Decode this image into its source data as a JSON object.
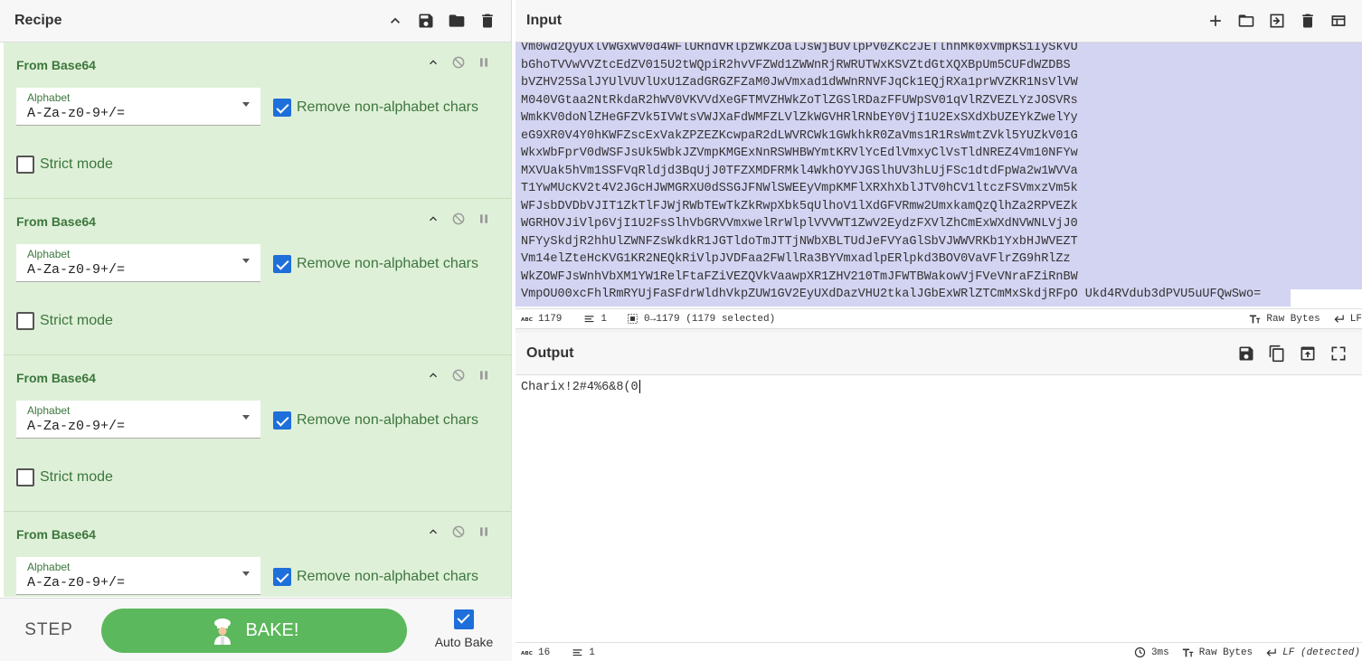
{
  "recipe": {
    "title": "Recipe",
    "header_icons": [
      "chevron-up-icon",
      "save-icon",
      "folder-icon",
      "trash-icon"
    ],
    "operations": [
      {
        "name": "From Base64",
        "alphabet_label": "Alphabet",
        "alphabet_value": "A-Za-z0-9+/=",
        "remove_label": "Remove non-alphabet chars",
        "remove_checked": true,
        "strict_label": "Strict mode",
        "strict_checked": false
      },
      {
        "name": "From Base64",
        "alphabet_label": "Alphabet",
        "alphabet_value": "A-Za-z0-9+/=",
        "remove_label": "Remove non-alphabet chars",
        "remove_checked": true,
        "strict_label": "Strict mode",
        "strict_checked": false
      },
      {
        "name": "From Base64",
        "alphabet_label": "Alphabet",
        "alphabet_value": "A-Za-z0-9+/=",
        "remove_label": "Remove non-alphabet chars",
        "remove_checked": true,
        "strict_label": "Strict mode",
        "strict_checked": false
      },
      {
        "name": "From Base64",
        "alphabet_label": "Alphabet",
        "alphabet_value": "A-Za-z0-9+/=",
        "remove_label": "Remove non-alphabet chars",
        "remove_checked": true,
        "strict_label": "Strict mode",
        "strict_checked": false
      }
    ],
    "step_label": "STEP",
    "bake_label": "BAKE!",
    "auto_bake_label": "Auto Bake",
    "auto_bake_checked": true
  },
  "input": {
    "title": "Input",
    "header_icons": [
      "plus-icon",
      "folder-icon",
      "import-icon",
      "trash-icon",
      "layout-icon"
    ],
    "lines": [
      "Vm0wd2QyUXlVWGxWV0d4WFlURndVRlpzWkZOalJsWjBUVlpPV0ZKc2JETlhhMk0xVmpKS1IySkVU",
      "bGhoTVVwVVZtcEdZV015U2tWQpiR2hvVFZWd1ZWWnRjRWRUTWxKSVZtdGtXQXBpUm5CUFdWZDBS",
      "bVZHV25SalJYUlVUVlUxU1ZadGRGZFZaM0JwVmxad1dWWnRNVFJqCk1EQjRXa1prWVZKR1NsVlVW",
      "M040VGtaa2NtRkdaR2hWV0VKVVdXeGFTMVZHWkZoTlZGSlRDazFFUWpSV01qVlRZVEZLYzJOSVRs",
      "WmkKV0doNlZHeGFZVk5IVWtsVWJXaFdWMFZLVlZkWGVHRlRNbEY0VjI1U2ExSXdXbUZEYkZwelYy",
      "eG9XR0V4Y0hKWFZscExVakZPZEZKcwpaR2dLWVRCWk1GWkhkR0ZaVms1R1RsWmtZVkl5YUZkV01G",
      "WkxWbFprV0dWSFJsUk5WbkJZVmpKMGExNnRSWHBWYmtKRVlYcEdlVmxyClVsTldNREZ4Vm10NFYw",
      "MXVUak5hVm1SSFVqRldjd3BqUjJ0TFZXMDFRMkl4WkhOYVJGSlhUV3hLUjFSc1dtdFpWa2w1WVVa",
      "T1YwMUcKV2t4V2JGcHJWMGRXU0dSSGJFNWlSWEEyVmpKMFlXRXhXblJTV0hCV1ltczFSVmxzVm5k",
      "WFJsbDVDbVJIT1ZkTlFJWjRWbTEwTkZkRwpXbk5qUlhoV1lXdGFVRmw2UmxkamQzQlhZa2RPVEZk",
      "WGRHOVJiVlp6VjI1U2FsSlhVbGRVVmxwelRrWlplVVVWT1ZwV2EydzFXVlZhCmExWXdNVWNLVjJ0",
      "NFYySkdjR2hhUlZWNFZsWkdkR1JGTldoTmJTTjNWbXBLTUdJeFVYaGlSbVJWWVRKb1YxbHJWVEZT",
      "Vm14elZteHcKVG1KR2NEQkRiVlpJVDFaa2FWllRa3BYVmxadlpERlpkd3BOV0VaVFlrZG9hRlZz",
      "WkZOWFJsWnhVbXM1YW1RelFtaFZiVEZQVkVaawpXR1ZHV210TmJFWTBWakowVjFVeVNraFZiRnBW",
      "VmpOU00xcFhlRmRYUjFaSFdrWldhVkpZUW1GV2EyUXdDazVHU2tkalJGbExWRlZTCmMxSkdjRFpO Ukd4RVdub3dPVU5uUFQwSwo="
    ],
    "char_count": "1179",
    "line_count": "1",
    "selection": "0→1179 (1179 selected)",
    "encoding": "Raw Bytes",
    "eol": "LF"
  },
  "output": {
    "title": "Output",
    "header_icons": [
      "save-icon",
      "copy-icon",
      "replace-input-icon",
      "maximise-icon"
    ],
    "text": "Charix!2#4%6&8(0",
    "char_count": "16",
    "line_count": "1",
    "bake_time": "3ms",
    "encoding": "Raw Bytes",
    "eol": "LF (detected)"
  }
}
